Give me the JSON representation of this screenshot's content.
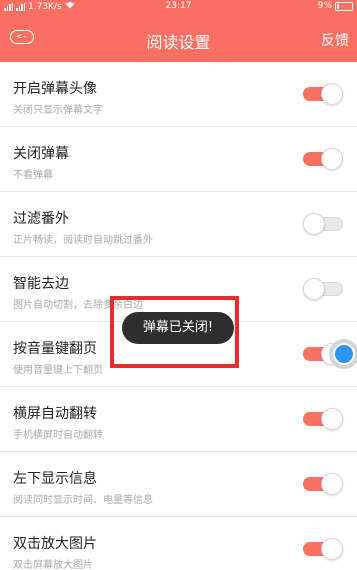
{
  "status_bar": {
    "network": "1.73K/s",
    "time": "23:17",
    "battery": "9%"
  },
  "nav": {
    "back_label": "<-",
    "title": "阅读设置",
    "feedback_label": "反馈"
  },
  "settings": [
    {
      "title": "开启弹幕头像",
      "subtitle": "关闭只显示弹幕文字",
      "enabled": true
    },
    {
      "title": "关闭弹幕",
      "subtitle": "不看弹幕",
      "enabled": true
    },
    {
      "title": "过滤番外",
      "subtitle": "正片畅读，阅读时自动跳过番外",
      "enabled": false
    },
    {
      "title": "智能去边",
      "subtitle": "图片自动切割，去除多余白边",
      "enabled": false
    },
    {
      "title": "按音量键翻页",
      "subtitle": "使用音量键上下翻页",
      "enabled": true
    },
    {
      "title": "横屏自动翻转",
      "subtitle": "手机横屏时自动翻转",
      "enabled": true
    },
    {
      "title": "左下显示信息",
      "subtitle": "阅读同时显示时间、电量等信息",
      "enabled": true
    },
    {
      "title": "双击放大图片",
      "subtitle": "双击屏幕放大图片",
      "enabled": true
    }
  ],
  "toast": {
    "text": "弹幕已关闭!"
  },
  "colors": {
    "accent": "#f96f62",
    "toggle_on": "#f8705f",
    "highlight": "#e82b2b",
    "touch": "#2a96ef"
  }
}
